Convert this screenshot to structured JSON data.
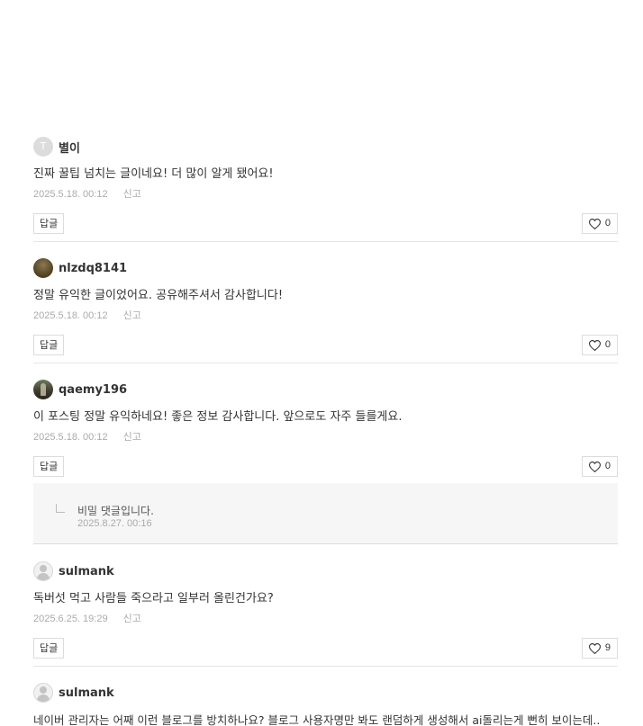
{
  "comments": [
    {
      "avatar_letter": "T",
      "author": "별이",
      "text": "진짜 꿀팁 넘치는 글이네요! 더 많이 알게 됐어요!",
      "date": "2025.5.18. 00:12",
      "report": "신고",
      "reply": "답글",
      "likes": "0"
    },
    {
      "author": "nlzdq8141",
      "text": "정말 유익한 글이었어요. 공유해주셔서 감사합니다!",
      "date": "2025.5.18. 00:12",
      "report": "신고",
      "reply": "답글",
      "likes": "0"
    },
    {
      "author": "qaemy196",
      "text": "이 포스팅 정말 유익하네요! 좋은 정보 감사합니다. 앞으로도 자주 들를게요.",
      "date": "2025.5.18. 00:12",
      "report": "신고",
      "reply": "답글",
      "likes": "0"
    },
    {
      "author": "sulmank",
      "text": "독버섯 먹고 사람들 죽으라고 일부러 올린건가요?",
      "date": "2025.6.25. 19:29",
      "report": "신고",
      "reply": "답글",
      "likes": "9"
    },
    {
      "author": "sulmank",
      "text": "네이버 관리자는 어째 이런 블로그를 방치하나요? 블로그 사용자명만 봐도 랜덤하게 생성해서 ai돌리는게 뻔히 보이는데.."
    }
  ],
  "secret_reply": {
    "label": "비밀 댓글입니다.",
    "date": "2025.8.27. 00:16"
  },
  "icons": {
    "like": "heart-outline-icon",
    "reply_branch": "reply-branch-icon"
  }
}
